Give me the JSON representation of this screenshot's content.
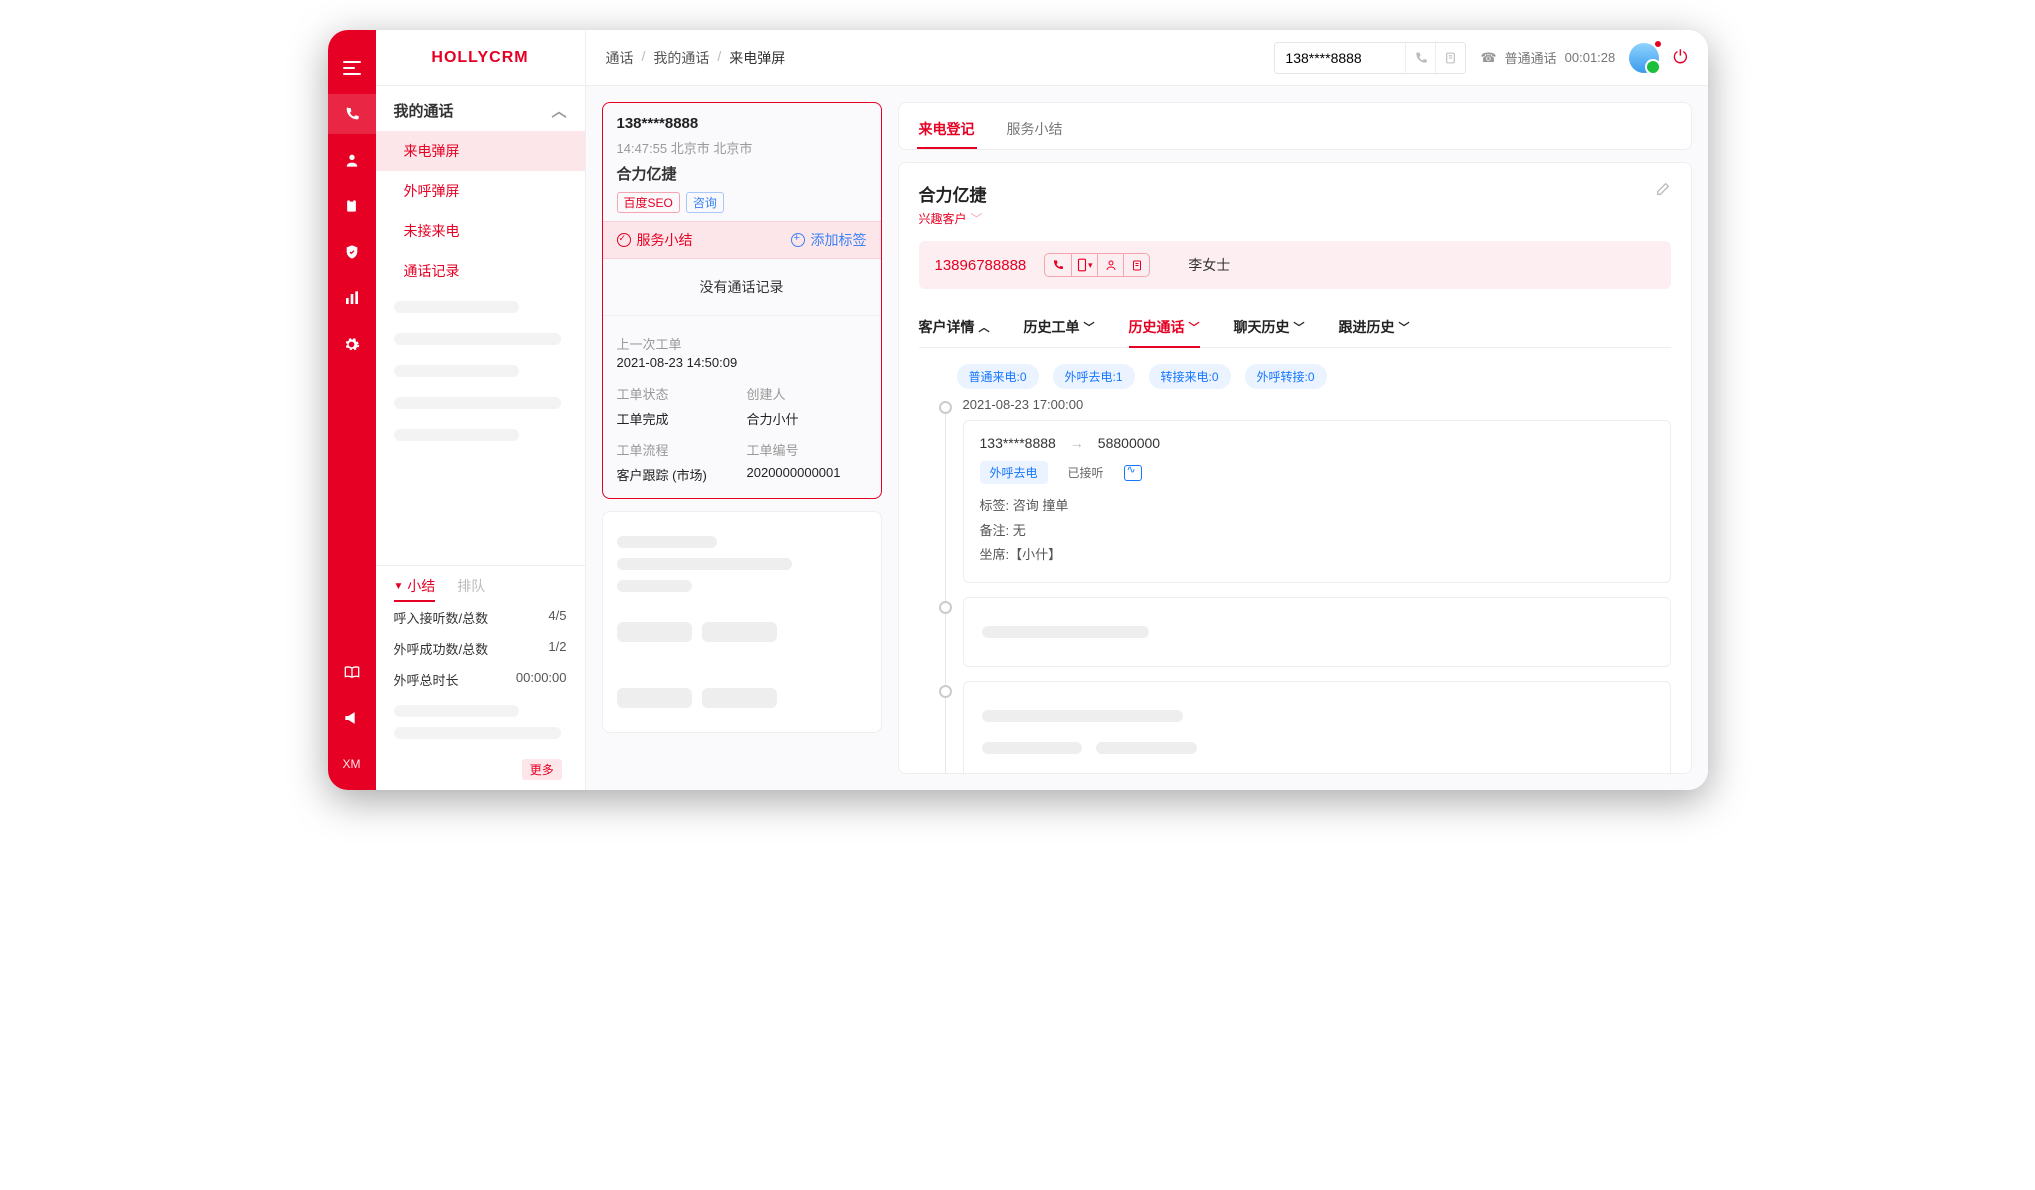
{
  "brand": "HOLLYCRM",
  "rail_labels": {
    "xm": "XM"
  },
  "breadcrumbs": {
    "a": "通话",
    "b": "我的通话",
    "c": "来电弹屏"
  },
  "topbar": {
    "phone_value": "138****8888",
    "status_label": "普通通话",
    "status_time": "00:01:28"
  },
  "sidebar": {
    "group": "我的通话",
    "items": [
      "来电弹屏",
      "外呼弹屏",
      "未接来电",
      "通话记录"
    ],
    "mini_tabs": {
      "summary": "小结",
      "queue": "排队"
    },
    "stats": {
      "in_label": "呼入接听数/总数",
      "in_val": "4/5",
      "out_label": "外呼成功数/总数",
      "out_val": "1/2",
      "dur_label": "外呼总时长",
      "dur_val": "00:00:00"
    },
    "more": "更多"
  },
  "call_card": {
    "number": "138****8888",
    "time_loc": "14:47:55 北京市  北京市",
    "company": "合力亿捷",
    "tags": {
      "seo": "百度SEO",
      "consult": "咨询"
    },
    "bar_left": "服务小结",
    "bar_right": "添加标签",
    "no_record": "没有通话记录",
    "last_ticket_label": "上一次工单",
    "last_ticket_time": "2021-08-23 14:50:09",
    "status_label": "工单状态",
    "creator_label": "创建人",
    "status_val": "工单完成",
    "creator_val": "合力小什",
    "flow_label": "工单流程",
    "no_label": "工单编号",
    "flow_val": "客户跟踪 (市场)",
    "no_val": "2020000000001"
  },
  "detail": {
    "tabs": {
      "register": "来电登记",
      "summary": "服务小结"
    },
    "company": "合力亿捷",
    "cust_type": "兴趣客户",
    "phone": "13896788888",
    "owner": "李女士",
    "sub_tabs": {
      "info": "客户详情",
      "ticket": "历史工单",
      "call": "历史通话",
      "chat": "聊天历史",
      "follow": "跟进历史"
    },
    "pills": {
      "p1": "普通来电:0",
      "p2": "外呼去电:1",
      "p3": "转接来电:0",
      "p4": "外呼转接:0"
    },
    "event": {
      "time": "2021-08-23  17:00:00",
      "from": "133****8888",
      "to": "58800000",
      "chip1": "外呼去电",
      "chip2": "已接听",
      "tag_line_label": "标签:",
      "tag_line_val": "咨询   撞单",
      "remark_label": "备注:",
      "remark_val": "无",
      "agent_label": "坐席:",
      "agent_val": "【小什】"
    }
  }
}
